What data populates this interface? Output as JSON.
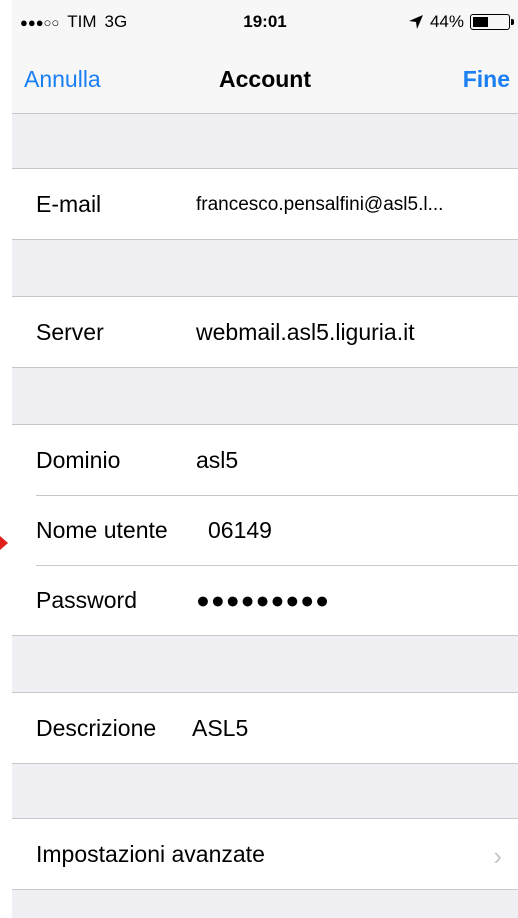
{
  "status": {
    "carrier": "TIM",
    "network": "3G",
    "time": "19:01",
    "battery": "44%",
    "battery_level": 0.44
  },
  "nav": {
    "cancel": "Annulla",
    "title": "Account",
    "done": "Fine"
  },
  "account": {
    "email": {
      "label": "E-mail",
      "value": "francesco.pensalfini@asl5.l..."
    },
    "server": {
      "label": "Server",
      "value": "webmail.asl5.liguria.it"
    },
    "domain": {
      "label": "Dominio",
      "value": "asl5"
    },
    "username": {
      "label": "Nome utente",
      "value": "06149"
    },
    "password": {
      "label": "Password",
      "value": "●●●●●●●●●"
    },
    "description": {
      "label": "Descrizione",
      "value": "ASL5"
    },
    "advanced": {
      "label": "Impostazioni avanzate"
    }
  }
}
